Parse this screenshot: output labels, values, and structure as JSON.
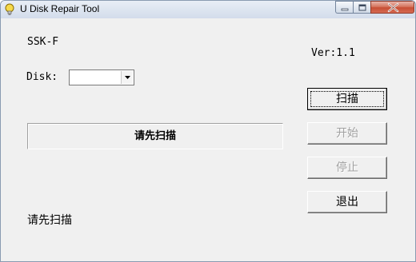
{
  "window": {
    "title": "U Disk Repair Tool",
    "icon": "lightbulb-icon",
    "controls": [
      "minimize-icon",
      "maximize-icon",
      "close-icon"
    ]
  },
  "device_name": "SSK-F",
  "version": "Ver:1.1",
  "disk": {
    "label": "Disk:",
    "selected": ""
  },
  "status_panel_text": "请先扫描",
  "buttons": {
    "scan": "扫描",
    "start": "开始",
    "stop": "停止",
    "exit": "退出"
  },
  "bottom_status": "请先扫描",
  "colors": {
    "window_bg": "#f0f0f0",
    "close_button": "#c74f35",
    "disabled_text": "#a0a0a0"
  }
}
